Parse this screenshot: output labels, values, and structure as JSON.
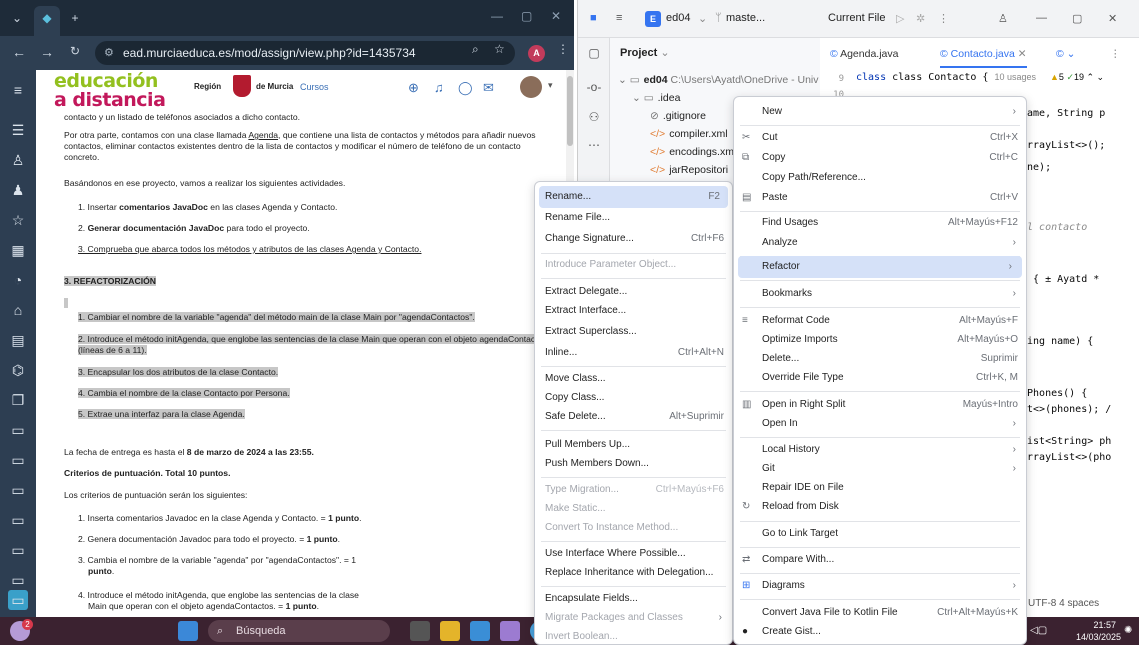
{
  "browser": {
    "url": "ead.murciaeduca.es/mod/assign/view.php?id=1435734",
    "profile_initial": "A",
    "logo_line1": "educación",
    "logo_line2": "a distancia",
    "region_label": "Región",
    "region_name": "de Murcia",
    "nav_cursos": "Cursos"
  },
  "page": {
    "p1": "contacto y un listado de teléfonos asociados a dicho contacto.",
    "p2a": "Por otra parte, contamos con una clase llamada ",
    "p2_agenda": "Agenda",
    "p2b": ", que contiene una lista de contactos y métodos para añadir nuevos contactos, eliminar contactos existentes dentro de la lista de contactos y  modificar el número de teléfono de un contacto concreto.",
    "p3": "Basándonos en ese proyecto, vamos a realizar los siguientes actividades.",
    "act1_a": "1. Insertar ",
    "act1_b": "comentarios JavaDoc",
    "act1_c": " en las clases Agenda y Contacto.",
    "act2_a": "2. ",
    "act2_b": "Generar documentación JavaDoc",
    "act2_c": " para todo el proyecto.",
    "act3": "3. Comprueba que abarca todos los métodos y atributos de las clases Agenda y Contacto.",
    "section_refactor": "3. REFACTORIZACIÓN",
    "ref1": "1. Cambiar el nombre de la variable \"agenda\" del método main de la clase Main por \"agendaContactos\".",
    "ref2": "2. Introduce el método initAgenda, que englobe las sentencias de la clase Main que operan con el objeto agendaContactos (líneas de 6 a 11).",
    "ref3": "3. Encapsular los dos atributos de la clase Contacto.",
    "ref4": "4. Cambia el nombre de la clase Contacto por Persona.",
    "ref5": "5. Extrae una interfaz para la clase Agenda.",
    "deadline_a": "La fecha de entrega es hasta el ",
    "deadline_b": "8 de marzo de 2024  a las 23:55.",
    "criteria_title": "Criterios de puntuación. Total 10 puntos.",
    "criteria_intro": "Los criterios de puntuación serán los siguientes:",
    "crit1_a": "1. Inserta comentarios Javadoc en la clase Agenda y Contacto. = ",
    "crit1_b": "1 punto",
    "crit2_a": "2. Genera documentación Javadoc para todo el proyecto. = ",
    "crit2_b": "1 punto",
    "crit3_a": "3. Cambia el nombre de la variable \"agenda\" por \"agendaContactos\". = 1",
    "crit3_b": "punto",
    "crit4_a": "4. Introduce el método initAgenda, que englobe las sentencias de la clase",
    "crit4_b": "Main que operan con el objeto agendaContactos. = ",
    "crit4_c": "1 punto"
  },
  "taskbar": {
    "search_placeholder": "Búsqueda",
    "time": "21:57",
    "date": "14/03/2025",
    "notif_badge": "2"
  },
  "ide": {
    "project_badge": "E",
    "project_name": "ed04",
    "branch": "maste...",
    "run_config": "Current File",
    "project_label": "Project",
    "tree": {
      "root": "ed04",
      "root_path": "C:\\Users\\Ayatd\\OneDrive - Univ",
      "idea": ".idea",
      "gitignore": ".gitignore",
      "compiler": "compiler.xml",
      "encodings": "encodings.xml",
      "jar": "jarRepositori"
    },
    "tabs": {
      "agenda": "Agenda.java",
      "contacto": "Contacto.java"
    },
    "editor": {
      "line9": "9",
      "line10": "10",
      "class_decl": "class Contacto {",
      "usages": "10 usages",
      "warn_count": "5",
      "ok_count": "19",
      "c1": "name, String p",
      "c2": "ArrayList<>();",
      "c3": "one);",
      "c4": "el contacto",
      "c5": ") {  ± Ayatd *",
      "c6": "ring name) {",
      "c7": "tPhones() {",
      "c8": "st<>(phones); /",
      "c9": "List<String> ph",
      "c10": "ArrayList<>(pho"
    },
    "status": "UTF-8   4 spaces"
  },
  "menu_main": {
    "new": "New",
    "cut": "Cut",
    "cut_sc": "Ctrl+X",
    "copy": "Copy",
    "copy_sc": "Ctrl+C",
    "copy_path": "Copy Path/Reference...",
    "paste": "Paste",
    "paste_sc": "Ctrl+V",
    "find_usages": "Find Usages",
    "find_usages_sc": "Alt+Mayús+F12",
    "analyze": "Analyze",
    "refactor": "Refactor",
    "bookmarks": "Bookmarks",
    "reformat": "Reformat Code",
    "reformat_sc": "Alt+Mayús+F",
    "optimize": "Optimize Imports",
    "optimize_sc": "Alt+Mayús+O",
    "delete": "Delete...",
    "delete_sc": "Suprimir",
    "override_type": "Override File Type",
    "override_type_sc": "Ctrl+K, M",
    "open_split": "Open in Right Split",
    "open_split_sc": "Mayús+Intro",
    "open_in": "Open In",
    "local_history": "Local History",
    "git": "Git",
    "repair": "Repair IDE on File",
    "reload": "Reload from Disk",
    "go_link": "Go to Link Target",
    "compare": "Compare With...",
    "diagrams": "Diagrams",
    "convert_kotlin": "Convert Java File to Kotlin File",
    "convert_kotlin_sc": "Ctrl+Alt+Mayús+K",
    "create_gist": "Create Gist..."
  },
  "menu_refactor": {
    "rename": "Rename...",
    "rename_sc": "F2",
    "rename_file": "Rename File...",
    "change_sig": "Change Signature...",
    "change_sig_sc": "Ctrl+F6",
    "intro_param_obj": "Introduce Parameter Object...",
    "extract_delegate": "Extract Delegate...",
    "extract_interface": "Extract Interface...",
    "extract_superclass": "Extract Superclass...",
    "inline": "Inline...",
    "inline_sc": "Ctrl+Alt+N",
    "move_class": "Move Class...",
    "copy_class": "Copy Class...",
    "safe_delete": "Safe Delete...",
    "safe_delete_sc": "Alt+Suprimir",
    "pull_up": "Pull Members Up...",
    "push_down": "Push Members Down...",
    "type_migration": "Type Migration...",
    "type_migration_sc": "Ctrl+Mayús+F6",
    "make_static": "Make Static...",
    "convert_instance": "Convert To Instance Method...",
    "use_interface": "Use Interface Where Possible...",
    "replace_inheritance": "Replace Inheritance with Delegation...",
    "encapsulate": "Encapsulate Fields...",
    "migrate_packages": "Migrate Packages and Classes",
    "invert_boolean": "Invert Boolean..."
  }
}
